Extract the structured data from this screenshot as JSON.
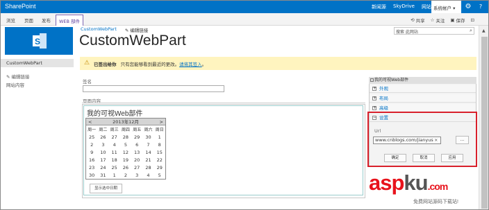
{
  "suite": {
    "brand": "SharePoint",
    "links": [
      "新闻源",
      "SkyDrive",
      "网站"
    ],
    "account": "系统帐户 ▾"
  },
  "ribbon": {
    "tabs": [
      "浏览",
      "页面",
      "发布"
    ],
    "active_tab": "WEB 部件",
    "actions": {
      "share": "共享",
      "follow": "关注",
      "save": "保存"
    }
  },
  "breadcrumb": {
    "site": "CustomWebPart",
    "edit_links": "编辑链接"
  },
  "page_title": "CustomWebPart",
  "search": {
    "placeholder": "搜索 此网站"
  },
  "left_nav": {
    "current": "CustomWebPart",
    "edit_links": "编辑链接",
    "site_contents": "网站内容"
  },
  "message": {
    "status": "已签出给你",
    "text": "只有您能够看到最近的更改。",
    "link": "请将其签入",
    "end": "。"
  },
  "form": {
    "title_label": "签名",
    "content_label": "页面内容"
  },
  "webpart": {
    "title": "我的可视Web部件",
    "calendar": {
      "prev": "<",
      "next": ">",
      "month": "2013年12月",
      "weekdays": [
        "周一",
        "周二",
        "周三",
        "周四",
        "周五",
        "周六",
        "周日"
      ],
      "weeks": [
        [
          "25",
          "26",
          "27",
          "28",
          "29",
          "30",
          "1"
        ],
        [
          "2",
          "3",
          "4",
          "5",
          "6",
          "7",
          "8"
        ],
        [
          "9",
          "10",
          "11",
          "12",
          "13",
          "14",
          "15"
        ],
        [
          "16",
          "17",
          "18",
          "19",
          "20",
          "21",
          "22"
        ],
        [
          "23",
          "24",
          "25",
          "26",
          "27",
          "28",
          "29"
        ],
        [
          "30",
          "31",
          "1",
          "2",
          "3",
          "4",
          "5"
        ]
      ]
    },
    "show_date_button": "显示选中日期"
  },
  "tool_pane": {
    "title": "我的可视Web部件",
    "sections": [
      "外观",
      "布局",
      "高级"
    ],
    "settings": {
      "label": "设置",
      "url_label": "Url",
      "url_value": "www.cnblogs.com/jianyus",
      "browse": "...",
      "ok": "确定",
      "cancel": "取消",
      "apply": "应用"
    }
  },
  "watermark": {
    "asp": "asp",
    "ku": "ku",
    "com": ".com",
    "tagline": "免费网站源码下载站!"
  }
}
